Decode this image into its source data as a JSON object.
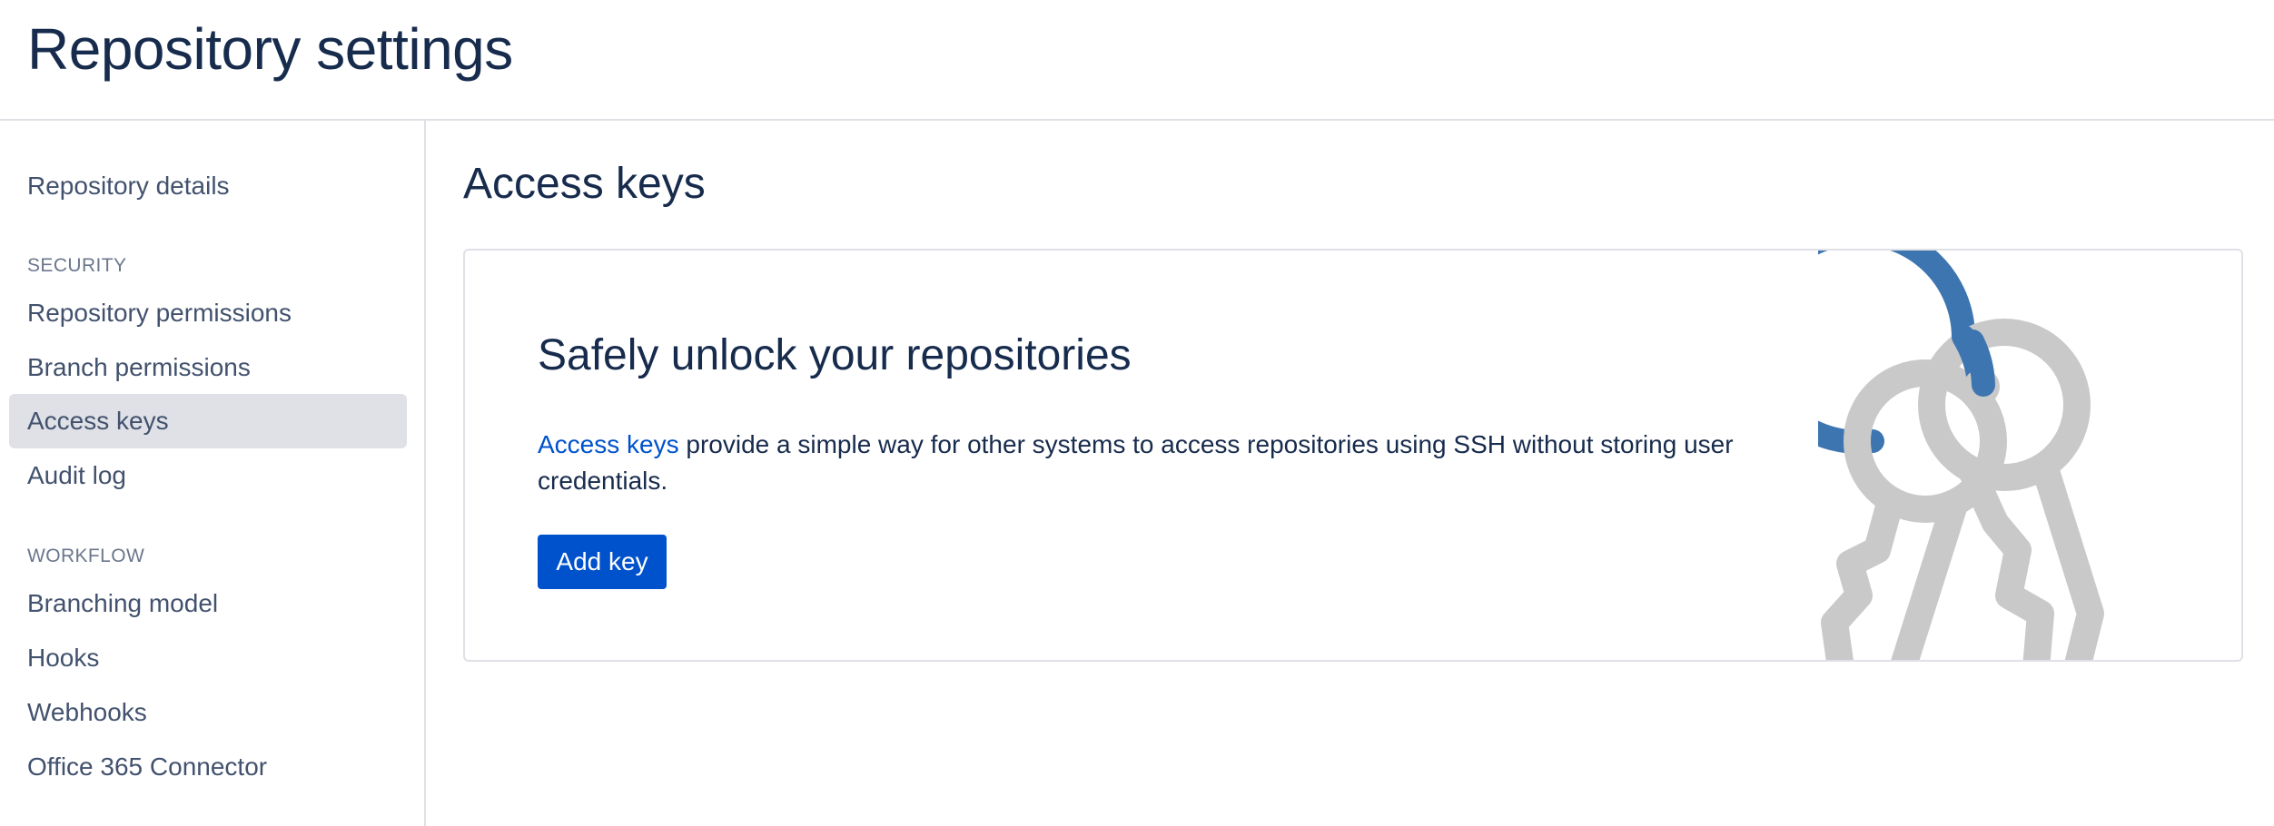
{
  "header": {
    "title": "Repository settings"
  },
  "sidebar": {
    "top_item": "Repository details",
    "sections": [
      {
        "heading": "SECURITY",
        "items": [
          "Repository permissions",
          "Branch permissions",
          "Access keys",
          "Audit log"
        ]
      },
      {
        "heading": "WORKFLOW",
        "items": [
          "Branching model",
          "Hooks",
          "Webhooks",
          "Office 365 Connector"
        ]
      }
    ],
    "selected_item": "Access keys"
  },
  "main": {
    "title": "Access keys",
    "card": {
      "heading": "Safely unlock your repositories",
      "link_text": "Access keys",
      "description": " provide a simple way for other systems to access repositories using SSH without storing user credentials.",
      "button_label": "Add key"
    }
  },
  "colors": {
    "primary": "#0052cc",
    "text": "#172b4d",
    "nav_text": "#42526e",
    "selected_bg": "#dfe1e6",
    "key_ring": "#3d75b1",
    "key_grey": "#c9c9c9"
  },
  "icons": {
    "illustration": "keys-on-ring-illustration"
  }
}
